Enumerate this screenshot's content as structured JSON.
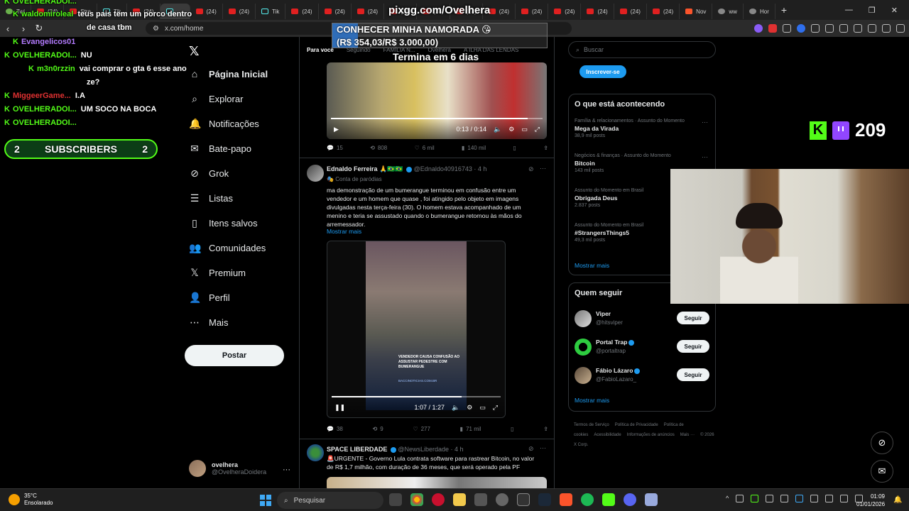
{
  "browser": {
    "tabs": [
      {
        "label": "Twi",
        "icon": "twitch"
      },
      {
        "label": "(24)",
        "icon": "youtube"
      },
      {
        "label": "Stre",
        "icon": "youtube"
      },
      {
        "label": "Tik",
        "icon": "tiktok"
      },
      {
        "label": "(24)",
        "icon": "youtube"
      },
      {
        "label": "",
        "icon": "tiktok-audio",
        "active": true
      },
      {
        "label": "(24)",
        "icon": "youtube"
      },
      {
        "label": "(24)",
        "icon": "youtube"
      },
      {
        "label": "Tik",
        "icon": "tiktok"
      },
      {
        "label": "(24)",
        "icon": "youtube"
      },
      {
        "label": "(24)",
        "icon": "youtube"
      },
      {
        "label": "(24)",
        "icon": "youtube"
      },
      {
        "label": "(24)",
        "icon": "youtube"
      },
      {
        "label": "(24)",
        "icon": "youtube"
      },
      {
        "label": "(24)",
        "icon": "youtube"
      },
      {
        "label": "(24)",
        "icon": "youtube"
      },
      {
        "label": "(24)",
        "icon": "youtube"
      },
      {
        "label": "(24)",
        "icon": "youtube"
      },
      {
        "label": "(24)",
        "icon": "youtube"
      },
      {
        "label": "(24)",
        "icon": "youtube"
      },
      {
        "label": "(24)",
        "icon": "youtube"
      },
      {
        "label": "Nov",
        "icon": "brave"
      },
      {
        "label": "ww",
        "icon": "web"
      },
      {
        "label": "Hor",
        "icon": "web"
      }
    ],
    "url": "x.com/home"
  },
  "stream": {
    "chat": [
      {
        "user": "OVELHERADOI...",
        "message": "",
        "color": "#53fc18",
        "badge": true
      },
      {
        "user": "waldomiroleal",
        "message": "teus pais tem um porco dentro",
        "color": "#53fc18",
        "badge": true
      },
      {
        "user": "",
        "message": "de casa tbm",
        "color": "#ffffff",
        "badge": false
      },
      {
        "user": "Evangelicos01",
        "message": "",
        "color": "#b47cff",
        "badge": true
      },
      {
        "user": "OVELHERADOI...",
        "message": "NU",
        "color": "#53fc18",
        "badge": true
      },
      {
        "user": "m3n0rzzin",
        "message": "vai comprar o gta 6 esse ano",
        "color": "#53fc18",
        "badge": true
      },
      {
        "user": "",
        "message": "ze?",
        "color": "#ffffff",
        "badge": false
      },
      {
        "user": "",
        "message": "",
        "color": "#ffffff",
        "badge": false
      },
      {
        "user": "MiggeerGame...",
        "message": "I.A",
        "color": "#e03131",
        "badge": true
      },
      {
        "user": "OVELHERADOI...",
        "message": "UM SOCO NA BOCA",
        "color": "#53fc18",
        "badge": true
      },
      {
        "user": "OVELHERADOI...",
        "message": "",
        "color": "#53fc18",
        "badge": true
      }
    ],
    "subscribers": {
      "left": "2",
      "label": "SUBSCRIBERS",
      "right": "2"
    },
    "pix_url": "pixgg.com/Ovelhera",
    "goal": {
      "line1": "CONHECER MINHA NAMORADA 😘",
      "line2": "(R$ 354,03/R$ 3.000,00)",
      "progress": 0.118,
      "time": "Termina em 6 dias"
    },
    "viewers": "209"
  },
  "nav": {
    "items": [
      {
        "label": "Página Inicial",
        "icon": "home-icon",
        "bold": true
      },
      {
        "label": "Explorar",
        "icon": "search-icon"
      },
      {
        "label": "Notificações",
        "icon": "bell-icon"
      },
      {
        "label": "Bate-papo",
        "icon": "mail-icon"
      },
      {
        "label": "Grok",
        "icon": "grok-icon"
      },
      {
        "label": "Listas",
        "icon": "list-icon"
      },
      {
        "label": "Itens salvos",
        "icon": "bookmark-icon"
      },
      {
        "label": "Comunidades",
        "icon": "communities-icon"
      },
      {
        "label": "Premium",
        "icon": "x-icon"
      },
      {
        "label": "Perfil",
        "icon": "person-icon"
      },
      {
        "label": "Mais",
        "icon": "more-circle-icon"
      }
    ],
    "post_button": "Postar",
    "user": {
      "name": "ovelhera",
      "handle": "@OvelheraDoidera"
    }
  },
  "timeline": {
    "tabs": [
      "Para você",
      "Seguindo",
      "FAMÍLIA N...",
      "Ovelhera",
      "A ILHA DAS LENDAS"
    ],
    "video1": {
      "time": "0:13 / 0:14",
      "progress": 0.93
    },
    "tweet1_actions": {
      "replies": "15",
      "reposts": "808",
      "likes": "6 mil",
      "views": "140 mil"
    },
    "tweet2": {
      "name": "Ednaldo Ferreira 🙏🇧🇷🇧🇷",
      "handle": "@Ednaldo40916743 · 4 h",
      "label": "Conta de paródias",
      "text": "ma demonstração de um bumerangue terminou em confusão entre um vendedor e um homem que quase , foi atingido pelo objeto em imagens divulgadas nesta terça-feira (30). O homem estava acompanhado de um menino e teria se assustado quando o bumerangue retornou às mãos do arremessador.",
      "more": "Mostrar mais",
      "video_caption": "VENDEDOR CAUSA CONFUSÃO AO ASSUSTAR PEDESTRE COM BUMERANGUE",
      "video_source": "BACCINOTICIAS.COM.BR",
      "video_time": "1:07 / 1:27",
      "video_progress": 0.77,
      "actions": {
        "replies": "38",
        "reposts": "9",
        "likes": "277",
        "views": "71 mil"
      }
    },
    "tweet3": {
      "name": "SPACE LIBERDADE",
      "handle": "@NewsLiberdade · 4 h",
      "text": "🚨URGENTE - Governo Lula contrata software para rastrear Bitcoin, no valor de R$ 1,7 milhão, com duração de 36 meses, que será operado pela PF"
    }
  },
  "sidebar": {
    "search_placeholder": "Buscar",
    "subscribe": "Inscrever-se",
    "trends_title": "O que está acontecendo",
    "trends": [
      {
        "category": "Família & relacionamentos · Assunto do Momento",
        "title": "Mega da Virada",
        "count": "38,9 mil posts"
      },
      {
        "category": "Negócios & finanças · Assunto do Momento",
        "title": "Bitcoin",
        "count": "143 mil posts"
      },
      {
        "category": "Assunto do Momento em Brasil",
        "title": "Obrigada Deus",
        "count": "2.837 posts"
      },
      {
        "category": "Assunto do Momento em Brasil",
        "title": "#StrangersThings5",
        "count": "49,3 mil posts"
      }
    ],
    "trends_more": "Mostrar mais",
    "follow_title": "Quem seguir",
    "follow": [
      {
        "name": "Viper",
        "handle": "@hitsviper",
        "button": "Seguir",
        "verified": false
      },
      {
        "name": "Portal Trap",
        "handle": "@portaltrap",
        "button": "Seguir",
        "verified": true
      },
      {
        "name": "Fábio Lázaro",
        "handle": "@FabioLazaro_",
        "button": "Seguir",
        "verified": true
      }
    ],
    "follow_more": "Mostrar mais",
    "footer": [
      "Termos de Serviço",
      "Política de Privacidade",
      "Política de cookies",
      "Acessibilidade",
      "Informações de anúncios",
      "Mais ···",
      "© 2026 X Corp."
    ]
  },
  "taskbar": {
    "weather_temp": "35°C",
    "weather_desc": "Ensolarado",
    "search": "Pesquisar",
    "time": "01:09",
    "date": "01/01/2026"
  }
}
